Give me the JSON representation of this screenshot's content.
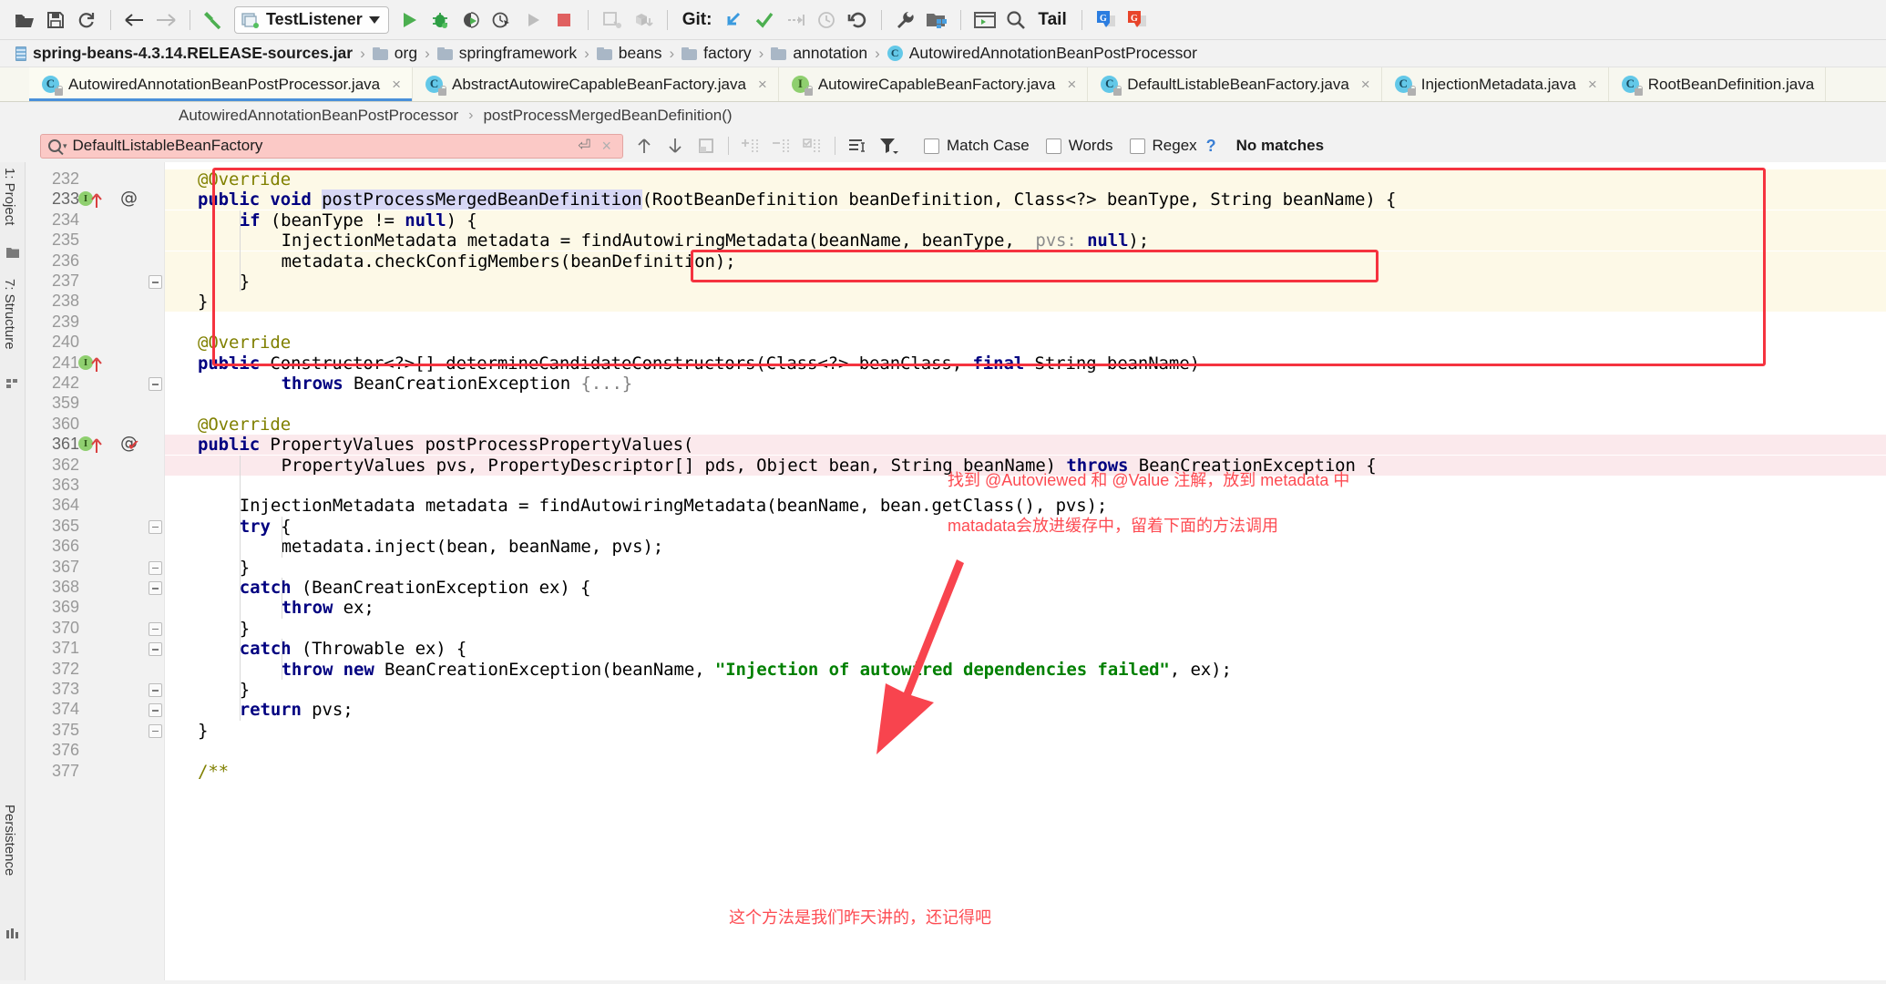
{
  "toolbar": {
    "icons_left": [
      "open-folder-icon",
      "save-all-icon",
      "sync-icon"
    ],
    "nav_back": "back-arrow-icon",
    "nav_forward": "forward-arrow-icon",
    "build_icon": "hammer-icon",
    "run_config_name": "TestListener",
    "run_icon": "run-icon",
    "debug_icon": "debug-icon",
    "run_coverage_icon": "run-with-coverage-icon",
    "profile_icon": "profiler-icon",
    "rerun_icon": "rerun-icon",
    "stop_icon": "stop-icon",
    "update_project_icon": "update-project-icon",
    "deploy_icon": "deploy-icon",
    "git_label": "Git:",
    "git_update_icon": "git-update-icon",
    "git_commit_icon": "git-commit-icon",
    "git_push_icon": "git-push-icon",
    "git_history_icon": "git-history-icon",
    "git_revert_icon": "git-revert-icon",
    "settings_icon": "wrench-icon",
    "project_structure_icon": "project-structure-icon",
    "terminal_icon": "terminal-icon",
    "search_everywhere_icon": "search-icon",
    "tail_label": "Tail",
    "translate_blue_icon": "google-translate-blue-icon",
    "translate_red_icon": "google-translate-red-icon"
  },
  "navbar": {
    "items": [
      {
        "label": "spring-beans-4.3.14.RELEASE-sources.jar",
        "icon": "jar-icon"
      },
      {
        "label": "org",
        "icon": "folder-icon"
      },
      {
        "label": "springframework",
        "icon": "folder-icon"
      },
      {
        "label": "beans",
        "icon": "folder-icon"
      },
      {
        "label": "factory",
        "icon": "folder-icon"
      },
      {
        "label": "annotation",
        "icon": "folder-icon"
      },
      {
        "label": "AutowiredAnnotationBeanPostProcessor",
        "icon": "class-icon"
      }
    ],
    "separator": "›"
  },
  "tabs": [
    {
      "label": "AutowiredAnnotationBeanPostProcessor.java",
      "kind": "class",
      "active": true,
      "close": "×"
    },
    {
      "label": "AbstractAutowireCapableBeanFactory.java",
      "kind": "class",
      "active": false,
      "close": "×"
    },
    {
      "label": "AutowireCapableBeanFactory.java",
      "kind": "interface",
      "active": false,
      "close": "×"
    },
    {
      "label": "DefaultListableBeanFactory.java",
      "kind": "class",
      "active": false,
      "close": "×"
    },
    {
      "label": "InjectionMetadata.java",
      "kind": "class",
      "active": false,
      "close": "×"
    },
    {
      "label": "RootBeanDefinition.java",
      "kind": "class",
      "active": false,
      "close": "×"
    }
  ],
  "crumb2": {
    "class": "AutowiredAnnotationBeanPostProcessor",
    "separator": "›",
    "method": "postProcessMergedBeanDefinition()"
  },
  "find": {
    "query": "DefaultListableBeanFactory",
    "placeholder": "Search",
    "history_icon": "search-dropdown-icon",
    "newline_icon": "multiline-icon",
    "clear_icon": "×",
    "prev_icon": "find-previous-icon",
    "next_icon": "find-next-icon",
    "select_all_icon": "select-all-occurrences-icon",
    "add_icon": "add-occurrence-icon",
    "remove_icon": "remove-occurrence-icon",
    "select_occurrences_icon": "select-occurrences-icon",
    "in_selection_icon": "find-in-selection-icon",
    "filter_icon": "filter-icon",
    "match_case_label": "Match Case",
    "words_label": "Words",
    "regex_label": "Regex",
    "help_label": "?",
    "status": "No matches",
    "match_case_checked": false,
    "words_checked": false,
    "regex_checked": false
  },
  "sidebar": {
    "left_top": [
      {
        "label": "1: Project",
        "icon": "project-folder-icon"
      },
      {
        "label": "7: Structure",
        "icon": "structure-icon"
      }
    ],
    "left_bottom": [
      {
        "label": "Persistence",
        "icon": "persistence-icon"
      }
    ]
  },
  "editor": {
    "line_numbers": [
      232,
      233,
      234,
      235,
      236,
      237,
      238,
      239,
      240,
      241,
      242,
      359,
      360,
      361,
      362,
      363,
      364,
      365,
      366,
      367,
      368,
      369,
      370,
      371,
      372,
      373,
      374,
      375,
      376,
      377
    ],
    "lines": [
      {
        "n": 232,
        "indent": 0,
        "tokens": [
          {
            "t": "@Override",
            "c": "an"
          }
        ]
      },
      {
        "n": 233,
        "indent": 0,
        "tokens": [
          {
            "t": "public ",
            "c": "k"
          },
          {
            "t": "void ",
            "c": "k"
          },
          {
            "t": "postProcessMergedBeanDefinition",
            "c": "mname-hl"
          },
          {
            "t": "(RootBeanDefinition beanDefinition, Class<?> beanType, String beanName) {",
            "c": "pl"
          }
        ]
      },
      {
        "n": 234,
        "indent": 1,
        "tokens": [
          {
            "t": "if ",
            "c": "k"
          },
          {
            "t": "(beanType != ",
            "c": "pl"
          },
          {
            "t": "null",
            "c": "k"
          },
          {
            "t": ") {",
            "c": "pl"
          }
        ]
      },
      {
        "n": 235,
        "indent": 2,
        "tokens": [
          {
            "t": "InjectionMetadata metadata = ",
            "c": "pl"
          },
          {
            "t": "findAutowiringMetadata(beanName, beanType, ",
            "c": "pl"
          },
          {
            "t": " pvs:",
            "c": "hint"
          },
          {
            "t": " ",
            "c": "pl"
          },
          {
            "t": "null",
            "c": "k"
          },
          {
            "t": ");",
            "c": "pl"
          }
        ]
      },
      {
        "n": 236,
        "indent": 2,
        "tokens": [
          {
            "t": "metadata.checkConfigMembers(beanDefinition);",
            "c": "pl"
          }
        ]
      },
      {
        "n": 237,
        "indent": 1,
        "tokens": [
          {
            "t": "}",
            "c": "pl"
          }
        ]
      },
      {
        "n": 238,
        "indent": 0,
        "tokens": [
          {
            "t": "}",
            "c": "pl"
          }
        ]
      },
      {
        "n": 239,
        "indent": 0,
        "tokens": []
      },
      {
        "n": 240,
        "indent": 0,
        "tokens": [
          {
            "t": "@Override",
            "c": "an"
          }
        ]
      },
      {
        "n": 241,
        "indent": 0,
        "tokens": [
          {
            "t": "public ",
            "c": "k"
          },
          {
            "t": "Constructor<?>[] determineCandidateConstructors(Class<?> beanClass, ",
            "c": "pl"
          },
          {
            "t": "final ",
            "c": "k"
          },
          {
            "t": "String beanName)",
            "c": "pl"
          }
        ]
      },
      {
        "n": 242,
        "indent": 2,
        "tokens": [
          {
            "t": "throws ",
            "c": "k"
          },
          {
            "t": "BeanCreationException ",
            "c": "pl"
          },
          {
            "t": "{...}",
            "c": "brace-fold"
          }
        ]
      },
      {
        "n": 359,
        "indent": 0,
        "tokens": []
      },
      {
        "n": 360,
        "indent": 0,
        "tokens": [
          {
            "t": "@Override",
            "c": "an"
          }
        ]
      },
      {
        "n": 361,
        "indent": 0,
        "tokens": [
          {
            "t": "public ",
            "c": "k"
          },
          {
            "t": "PropertyValues postProcessPropertyValues(",
            "c": "pl"
          }
        ]
      },
      {
        "n": 362,
        "indent": 2,
        "tokens": [
          {
            "t": "PropertyValues pvs, PropertyDescriptor[] pds, Object bean, String beanName) ",
            "c": "pl"
          },
          {
            "t": "throws ",
            "c": "k"
          },
          {
            "t": "BeanCreationException {",
            "c": "pl"
          }
        ]
      },
      {
        "n": 363,
        "indent": 0,
        "tokens": []
      },
      {
        "n": 364,
        "indent": 1,
        "tokens": [
          {
            "t": "InjectionMetadata metadata = findAutowiringMetadata(beanName, bean.getClass(), pvs);",
            "c": "pl"
          }
        ]
      },
      {
        "n": 365,
        "indent": 1,
        "tokens": [
          {
            "t": "try ",
            "c": "k"
          },
          {
            "t": "{",
            "c": "pl"
          }
        ]
      },
      {
        "n": 366,
        "indent": 2,
        "tokens": [
          {
            "t": "metadata.inject(bean, beanName, pvs);",
            "c": "pl"
          }
        ]
      },
      {
        "n": 367,
        "indent": 1,
        "tokens": [
          {
            "t": "}",
            "c": "pl"
          }
        ]
      },
      {
        "n": 368,
        "indent": 1,
        "tokens": [
          {
            "t": "catch ",
            "c": "k"
          },
          {
            "t": "(BeanCreationException ex) {",
            "c": "pl"
          }
        ]
      },
      {
        "n": 369,
        "indent": 2,
        "tokens": [
          {
            "t": "throw ",
            "c": "k"
          },
          {
            "t": "ex;",
            "c": "pl"
          }
        ]
      },
      {
        "n": 370,
        "indent": 1,
        "tokens": [
          {
            "t": "}",
            "c": "pl"
          }
        ]
      },
      {
        "n": 371,
        "indent": 1,
        "tokens": [
          {
            "t": "catch ",
            "c": "k"
          },
          {
            "t": "(Throwable ex) {",
            "c": "pl"
          }
        ]
      },
      {
        "n": 372,
        "indent": 2,
        "tokens": [
          {
            "t": "throw ",
            "c": "k"
          },
          {
            "t": "new ",
            "c": "k"
          },
          {
            "t": "BeanCreationException(beanName, ",
            "c": "pl"
          },
          {
            "t": "\"Injection of autowired dependencies failed\"",
            "c": "st"
          },
          {
            "t": ", ex);",
            "c": "pl"
          }
        ]
      },
      {
        "n": 373,
        "indent": 1,
        "tokens": [
          {
            "t": "}",
            "c": "pl"
          }
        ]
      },
      {
        "n": 374,
        "indent": 1,
        "tokens": [
          {
            "t": "return ",
            "c": "k"
          },
          {
            "t": "pvs;",
            "c": "pl"
          }
        ]
      },
      {
        "n": 375,
        "indent": 0,
        "tokens": [
          {
            "t": "}",
            "c": "pl"
          }
        ]
      },
      {
        "n": 376,
        "indent": 0,
        "tokens": []
      },
      {
        "n": 377,
        "indent": 0,
        "tokens": [
          {
            "t": "/**",
            "c": "an"
          }
        ]
      }
    ],
    "gutter_markers": [
      {
        "line": 233,
        "kind": "implements",
        "glyph": "I"
      },
      {
        "line": 233,
        "kind": "overrides",
        "glyph": "↑"
      },
      {
        "line": 233,
        "kind": "annotation",
        "glyph": "@"
      },
      {
        "line": 241,
        "kind": "implements",
        "glyph": "I"
      },
      {
        "line": 241,
        "kind": "overrides",
        "glyph": "↑"
      },
      {
        "line": 361,
        "kind": "implements",
        "glyph": "I"
      },
      {
        "line": 361,
        "kind": "overrides",
        "glyph": "↑"
      },
      {
        "line": 361,
        "kind": "annotation",
        "glyph": "@"
      },
      {
        "line": 361,
        "kind": "bookmark",
        "glyph": "✔"
      }
    ]
  },
  "annotations": {
    "box_outer": "highlight-method-box",
    "box_inner": "highlight-call-box",
    "note1": "找到 @Autoviewed 和 @Value 注解，放到 metadata 中",
    "note2": "matadata会放进缓存中，留着下面的方法调用",
    "note3": "这个方法是我们昨天讲的，还记得吧",
    "arrow": "red-arrow-annotation",
    "color": "#fd4b52"
  }
}
